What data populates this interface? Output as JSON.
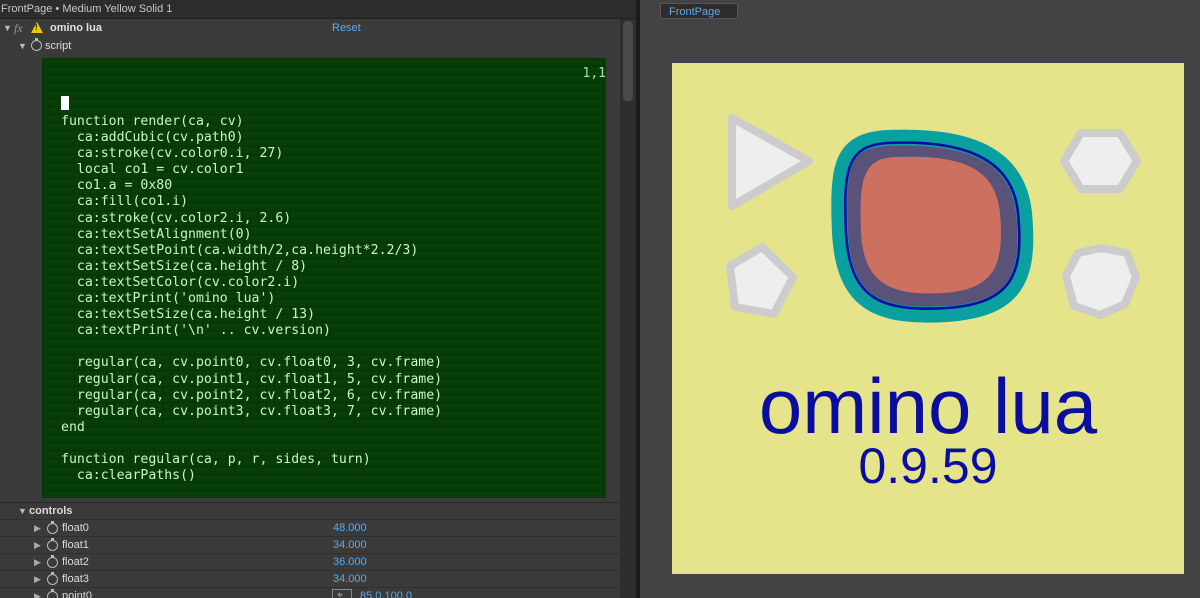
{
  "window": {
    "title": "FrontPage • Medium Yellow Solid 1"
  },
  "effect": {
    "fx_label": "fx",
    "name": "omino lua",
    "reset_label": "Reset",
    "script_label": "script"
  },
  "script_editor": {
    "cursor_position": "1,1",
    "code": "function render(ca, cv)\n  ca:addCubic(cv.path0)\n  ca:stroke(cv.color0.i, 27)\n  local co1 = cv.color1\n  co1.a = 0x80\n  ca:fill(co1.i)\n  ca:stroke(cv.color2.i, 2.6)\n  ca:textSetAlignment(0)\n  ca:textSetPoint(ca.width/2,ca.height*2.2/3)\n  ca:textSetSize(ca.height / 8)\n  ca:textSetColor(cv.color2.i)\n  ca:textPrint('omino lua')\n  ca:textSetSize(ca.height / 13)\n  ca:textPrint('\\n' .. cv.version)\n\n  regular(ca, cv.point0, cv.float0, 3, cv.frame)\n  regular(ca, cv.point1, cv.float1, 5, cv.frame)\n  regular(ca, cv.point2, cv.float2, 6, cv.frame)\n  regular(ca, cv.point3, cv.float3, 7, cv.frame)\nend\n\nfunction regular(ca, p, r, sides, turn)\n  ca:clearPaths()"
  },
  "controls": {
    "label": "controls",
    "items": [
      {
        "name": "float0",
        "value": "48.000"
      },
      {
        "name": "float1",
        "value": "34.000"
      },
      {
        "name": "float2",
        "value": "36.000"
      },
      {
        "name": "float3",
        "value": "34.000"
      },
      {
        "name": "point0",
        "value": "85.0,100.0"
      }
    ]
  },
  "composition": {
    "tab_label": "FrontPage",
    "title_text": "omino lua",
    "version_text": "0.9.59",
    "colors": {
      "background": "#e6e48a",
      "teal_outline": "#0aa0a0",
      "blob_fill": "#5a5278",
      "inner_fill": "#cc7060",
      "blue": "#0a0ea0",
      "shape_fill": "#eeeeee",
      "shape_stroke": "#cccccc"
    },
    "shapes": [
      {
        "kind": "triangle",
        "sides": 3
      },
      {
        "kind": "pentagon",
        "sides": 5
      },
      {
        "kind": "hexagon",
        "sides": 6
      },
      {
        "kind": "heptagon",
        "sides": 7
      }
    ]
  }
}
